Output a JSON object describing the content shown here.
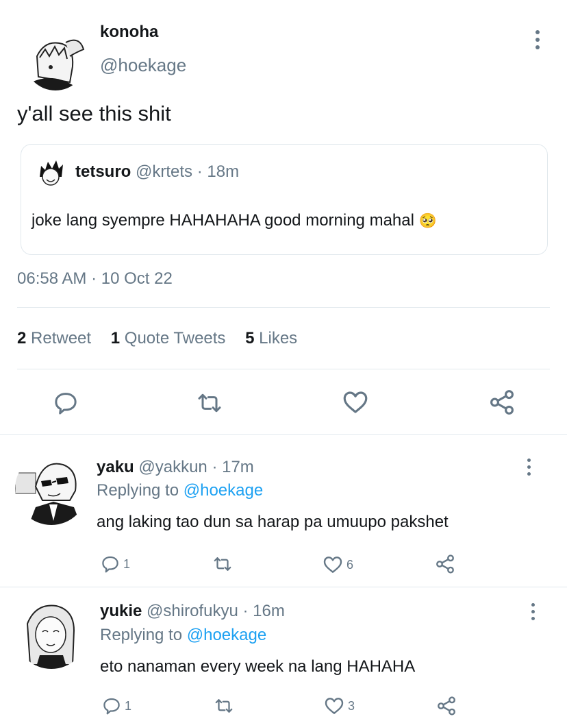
{
  "tweet": {
    "name": "konoha",
    "handle": "@hoekage",
    "text": "y'all see this shit",
    "quote": {
      "name": "tetsuro",
      "handle": "@krtets",
      "time": "· 18m",
      "text": "joke lang syempre HAHAHAHA good morning mahal",
      "emoji": "🥺"
    },
    "timestamp": "06:58 AM · 10 Oct 22",
    "stats": {
      "retweets": "2",
      "retweets_label": "Retweet",
      "quotes": "1",
      "quotes_label": "Quote Tweets",
      "likes": "5",
      "likes_label": "Likes"
    }
  },
  "replies": [
    {
      "name": "yaku",
      "handle": "@yakkun",
      "time": "· 17m",
      "replying_prefix": "Replying to",
      "replying_to": "@hoekage",
      "text": "ang laking tao dun sa harap pa umuupo pakshet",
      "reply_count": "1",
      "like_count": "6"
    },
    {
      "name": "yukie",
      "handle": "@shirofukyu",
      "time": "· 16m",
      "replying_prefix": "Replying to",
      "replying_to": "@hoekage",
      "text": "eto nanaman every week na lang HAHAHA",
      "reply_count": "1",
      "like_count": "3"
    }
  ],
  "colors": {
    "text": "#14171a",
    "secondary": "#657786",
    "link": "#1da1f2",
    "divider": "#e1e8ed"
  },
  "icons": [
    "more-icon",
    "reply-icon",
    "retweet-icon",
    "like-icon",
    "share-icon"
  ]
}
